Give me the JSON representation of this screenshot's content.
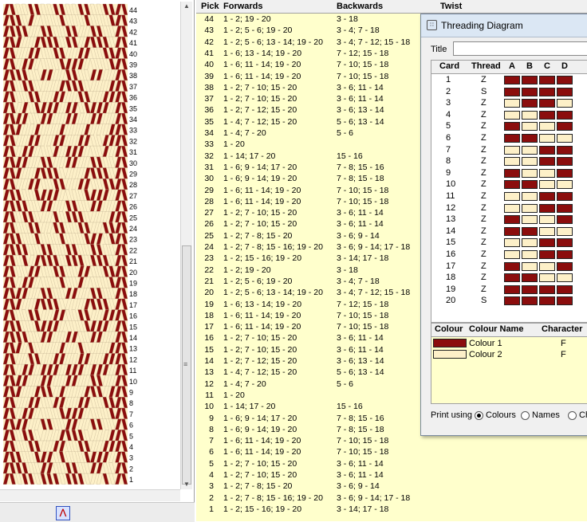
{
  "colors": {
    "colour1": "#8b0d0d",
    "colour2": "#fdf0c8",
    "panel_yellow": "#ffffcc"
  },
  "pattern": {
    "row_numbers": [
      "44",
      "43",
      "42",
      "41",
      "40",
      "39",
      "38",
      "37",
      "36",
      "35",
      "34",
      "33",
      "32",
      "31",
      "30",
      "29",
      "28",
      "27",
      "26",
      "25",
      "24",
      "23",
      "22",
      "21",
      "20",
      "19",
      "18",
      "17",
      "16",
      "15",
      "14",
      "13",
      "12",
      "11",
      "10",
      "9",
      "8",
      "7",
      "6",
      "5",
      "4",
      "3",
      "2",
      "1"
    ],
    "card_numbers": [
      "1",
      "2",
      "3",
      "4",
      "5",
      "6",
      "7",
      "8",
      "9",
      "10",
      "11",
      "12",
      "13",
      "14",
      "15",
      "16",
      "17",
      "18",
      "19",
      "20"
    ],
    "card_label": "Card",
    "toolbar_icon": "weave-icon"
  },
  "table": {
    "headers": {
      "pick": "Pick",
      "forwards": "Forwards",
      "backwards": "Backwards",
      "twist": "Twist"
    },
    "rows": [
      {
        "pick": "44",
        "fw": "1 - 2; 19 - 20",
        "bw": "3 - 18"
      },
      {
        "pick": "43",
        "fw": "1 - 2; 5 - 6; 19 - 20",
        "bw": "3 - 4; 7 - 18"
      },
      {
        "pick": "42",
        "fw": "1 - 2; 5 - 6; 13 - 14; 19 - 20",
        "bw": "3 - 4; 7 - 12; 15 - 18"
      },
      {
        "pick": "41",
        "fw": "1 - 6; 13 - 14; 19 - 20",
        "bw": "7 - 12; 15 - 18"
      },
      {
        "pick": "40",
        "fw": "1 - 6; 11 - 14; 19 - 20",
        "bw": "7 - 10; 15 - 18"
      },
      {
        "pick": "39",
        "fw": "1 - 6; 11 - 14; 19 - 20",
        "bw": "7 - 10; 15 - 18"
      },
      {
        "pick": "38",
        "fw": "1 - 2; 7 - 10; 15 - 20",
        "bw": "3 - 6; 11 - 14"
      },
      {
        "pick": "37",
        "fw": "1 - 2; 7 - 10; 15 - 20",
        "bw": "3 - 6; 11 - 14"
      },
      {
        "pick": "36",
        "fw": "1 - 2; 7 - 12; 15 - 20",
        "bw": "3 - 6; 13 - 14"
      },
      {
        "pick": "35",
        "fw": "1 - 4; 7 - 12; 15 - 20",
        "bw": "5 - 6; 13 - 14"
      },
      {
        "pick": "34",
        "fw": "1 - 4; 7 - 20",
        "bw": "5 - 6"
      },
      {
        "pick": "33",
        "fw": "1 - 20",
        "bw": ""
      },
      {
        "pick": "32",
        "fw": "1 - 14; 17 - 20",
        "bw": "15 - 16"
      },
      {
        "pick": "31",
        "fw": "1 - 6; 9 - 14; 17 - 20",
        "bw": "7 - 8; 15 - 16"
      },
      {
        "pick": "30",
        "fw": "1 - 6; 9 - 14; 19 - 20",
        "bw": "7 - 8; 15 - 18"
      },
      {
        "pick": "29",
        "fw": "1 - 6; 11 - 14; 19 - 20",
        "bw": "7 - 10; 15 - 18"
      },
      {
        "pick": "28",
        "fw": "1 - 6; 11 - 14; 19 - 20",
        "bw": "7 - 10; 15 - 18"
      },
      {
        "pick": "27",
        "fw": "1 - 2; 7 - 10; 15 - 20",
        "bw": "3 - 6; 11 - 14"
      },
      {
        "pick": "26",
        "fw": "1 - 2; 7 - 10; 15 - 20",
        "bw": "3 - 6; 11 - 14"
      },
      {
        "pick": "25",
        "fw": "1 - 2; 7 - 8; 15 - 20",
        "bw": "3 - 6; 9 - 14"
      },
      {
        "pick": "24",
        "fw": "1 - 2; 7 - 8; 15 - 16; 19 - 20",
        "bw": "3 - 6; 9 - 14; 17 - 18"
      },
      {
        "pick": "23",
        "fw": "1 - 2; 15 - 16; 19 - 20",
        "bw": "3 - 14; 17 - 18"
      },
      {
        "pick": "22",
        "fw": "1 - 2; 19 - 20",
        "bw": "3 - 18"
      },
      {
        "pick": "21",
        "fw": "1 - 2; 5 - 6; 19 - 20",
        "bw": "3 - 4; 7 - 18"
      },
      {
        "pick": "20",
        "fw": "1 - 2; 5 - 6; 13 - 14; 19 - 20",
        "bw": "3 - 4; 7 - 12; 15 - 18"
      },
      {
        "pick": "19",
        "fw": "1 - 6; 13 - 14; 19 - 20",
        "bw": "7 - 12; 15 - 18"
      },
      {
        "pick": "18",
        "fw": "1 - 6; 11 - 14; 19 - 20",
        "bw": "7 - 10; 15 - 18"
      },
      {
        "pick": "17",
        "fw": "1 - 6; 11 - 14; 19 - 20",
        "bw": "7 - 10; 15 - 18"
      },
      {
        "pick": "16",
        "fw": "1 - 2; 7 - 10; 15 - 20",
        "bw": "3 - 6; 11 - 14"
      },
      {
        "pick": "15",
        "fw": "1 - 2; 7 - 10; 15 - 20",
        "bw": "3 - 6; 11 - 14"
      },
      {
        "pick": "14",
        "fw": "1 - 2; 7 - 12; 15 - 20",
        "bw": "3 - 6; 13 - 14"
      },
      {
        "pick": "13",
        "fw": "1 - 4; 7 - 12; 15 - 20",
        "bw": "5 - 6; 13 - 14"
      },
      {
        "pick": "12",
        "fw": "1 - 4; 7 - 20",
        "bw": "5 - 6"
      },
      {
        "pick": "11",
        "fw": "1 - 20",
        "bw": ""
      },
      {
        "pick": "10",
        "fw": "1 - 14; 17 - 20",
        "bw": "15 - 16"
      },
      {
        "pick": "9",
        "fw": "1 - 6; 9 - 14; 17 - 20",
        "bw": "7 - 8; 15 - 16"
      },
      {
        "pick": "8",
        "fw": "1 - 6; 9 - 14; 19 - 20",
        "bw": "7 - 8; 15 - 18"
      },
      {
        "pick": "7",
        "fw": "1 - 6; 11 - 14; 19 - 20",
        "bw": "7 - 10; 15 - 18"
      },
      {
        "pick": "6",
        "fw": "1 - 6; 11 - 14; 19 - 20",
        "bw": "7 - 10; 15 - 18"
      },
      {
        "pick": "5",
        "fw": "1 - 2; 7 - 10; 15 - 20",
        "bw": "3 - 6; 11 - 14"
      },
      {
        "pick": "4",
        "fw": "1 - 2; 7 - 10; 15 - 20",
        "bw": "3 - 6; 11 - 14"
      },
      {
        "pick": "3",
        "fw": "1 - 2; 7 - 8; 15 - 20",
        "bw": "3 - 6; 9 - 14"
      },
      {
        "pick": "2",
        "fw": "1 - 2; 7 - 8; 15 - 16; 19 - 20",
        "bw": "3 - 6; 9 - 14; 17 - 18"
      },
      {
        "pick": "1",
        "fw": "1 - 2; 15 - 16; 19 - 20",
        "bw": "3 - 14; 17 - 18"
      }
    ]
  },
  "dialog": {
    "title": "Threading Diagram",
    "title_label": "Title",
    "title_value": "",
    "headers": {
      "card": "Card",
      "thread": "Thread",
      "a": "A",
      "b": "B",
      "c": "C",
      "d": "D"
    },
    "cards": [
      {
        "card": "1",
        "thread": "Z",
        "holes": [
          1,
          1,
          1,
          1
        ]
      },
      {
        "card": "2",
        "thread": "S",
        "holes": [
          1,
          1,
          1,
          1
        ]
      },
      {
        "card": "3",
        "thread": "Z",
        "holes": [
          2,
          1,
          1,
          2
        ]
      },
      {
        "card": "4",
        "thread": "Z",
        "holes": [
          2,
          2,
          1,
          1
        ]
      },
      {
        "card": "5",
        "thread": "Z",
        "holes": [
          1,
          2,
          2,
          1
        ]
      },
      {
        "card": "6",
        "thread": "Z",
        "holes": [
          1,
          1,
          2,
          2
        ]
      },
      {
        "card": "7",
        "thread": "Z",
        "holes": [
          2,
          2,
          1,
          1
        ]
      },
      {
        "card": "8",
        "thread": "Z",
        "holes": [
          2,
          2,
          1,
          1
        ]
      },
      {
        "card": "9",
        "thread": "Z",
        "holes": [
          1,
          2,
          2,
          1
        ]
      },
      {
        "card": "10",
        "thread": "Z",
        "holes": [
          1,
          1,
          2,
          2
        ]
      },
      {
        "card": "11",
        "thread": "Z",
        "holes": [
          2,
          2,
          1,
          1
        ]
      },
      {
        "card": "12",
        "thread": "Z",
        "holes": [
          2,
          2,
          1,
          1
        ]
      },
      {
        "card": "13",
        "thread": "Z",
        "holes": [
          1,
          2,
          2,
          1
        ]
      },
      {
        "card": "14",
        "thread": "Z",
        "holes": [
          1,
          1,
          2,
          2
        ]
      },
      {
        "card": "15",
        "thread": "Z",
        "holes": [
          2,
          2,
          1,
          1
        ]
      },
      {
        "card": "16",
        "thread": "Z",
        "holes": [
          2,
          2,
          1,
          1
        ]
      },
      {
        "card": "17",
        "thread": "Z",
        "holes": [
          1,
          2,
          2,
          1
        ]
      },
      {
        "card": "18",
        "thread": "Z",
        "holes": [
          1,
          1,
          2,
          2
        ]
      },
      {
        "card": "19",
        "thread": "Z",
        "holes": [
          1,
          1,
          1,
          1
        ]
      },
      {
        "card": "20",
        "thread": "S",
        "holes": [
          1,
          1,
          1,
          1
        ]
      }
    ],
    "colour_headers": {
      "colour": "Colour",
      "name": "Colour Name",
      "character": "Character"
    },
    "colours": [
      {
        "name": "Colour 1",
        "character": "F",
        "hex": "#8b0d0d"
      },
      {
        "name": "Colour 2",
        "character": "F",
        "hex": "#fdf0c8"
      }
    ],
    "print_using": {
      "label": "Print using",
      "options": [
        "Colours",
        "Names",
        "Ch"
      ],
      "selected": "Colours"
    }
  }
}
